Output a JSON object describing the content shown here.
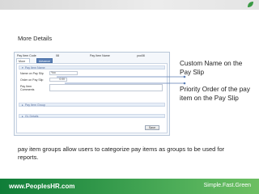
{
  "slide": {
    "title": "More Details",
    "caption": "pay item groups allow users to  categorize pay items as groups to be used for reports."
  },
  "form": {
    "header": {
      "code_label": "Pay Item Code",
      "code_value": "08",
      "name_label": "Pay Item Name",
      "name_value": "yoo08"
    },
    "tabs": [
      "More Details",
      "Advance Settings"
    ],
    "sections": {
      "pay_item_name": "Pay Item Name",
      "pay_item_group": "Pay Item Group",
      "gl_details": "GL Details"
    },
    "fields": {
      "name_on_slip_label": "Name on Pay Slip",
      "name_on_slip_value": "Yoo",
      "order_label": "Order on Pay Slip",
      "order_value": "0.00",
      "comments_label": "Pay Item Comments"
    },
    "save_label": "Save"
  },
  "callouts": {
    "custom_name": "Custom Name on the Pay Slip",
    "priority_order": "Priority Order of the pay item on the Pay Slip"
  },
  "footer": {
    "website": "www.PeoplesHR.com",
    "tagline": "Simple.Fast.Green"
  },
  "colors": {
    "footer_green": "#1e8b3e",
    "tab_blue": "#5a7fb5",
    "connector": "#5b7db5"
  }
}
